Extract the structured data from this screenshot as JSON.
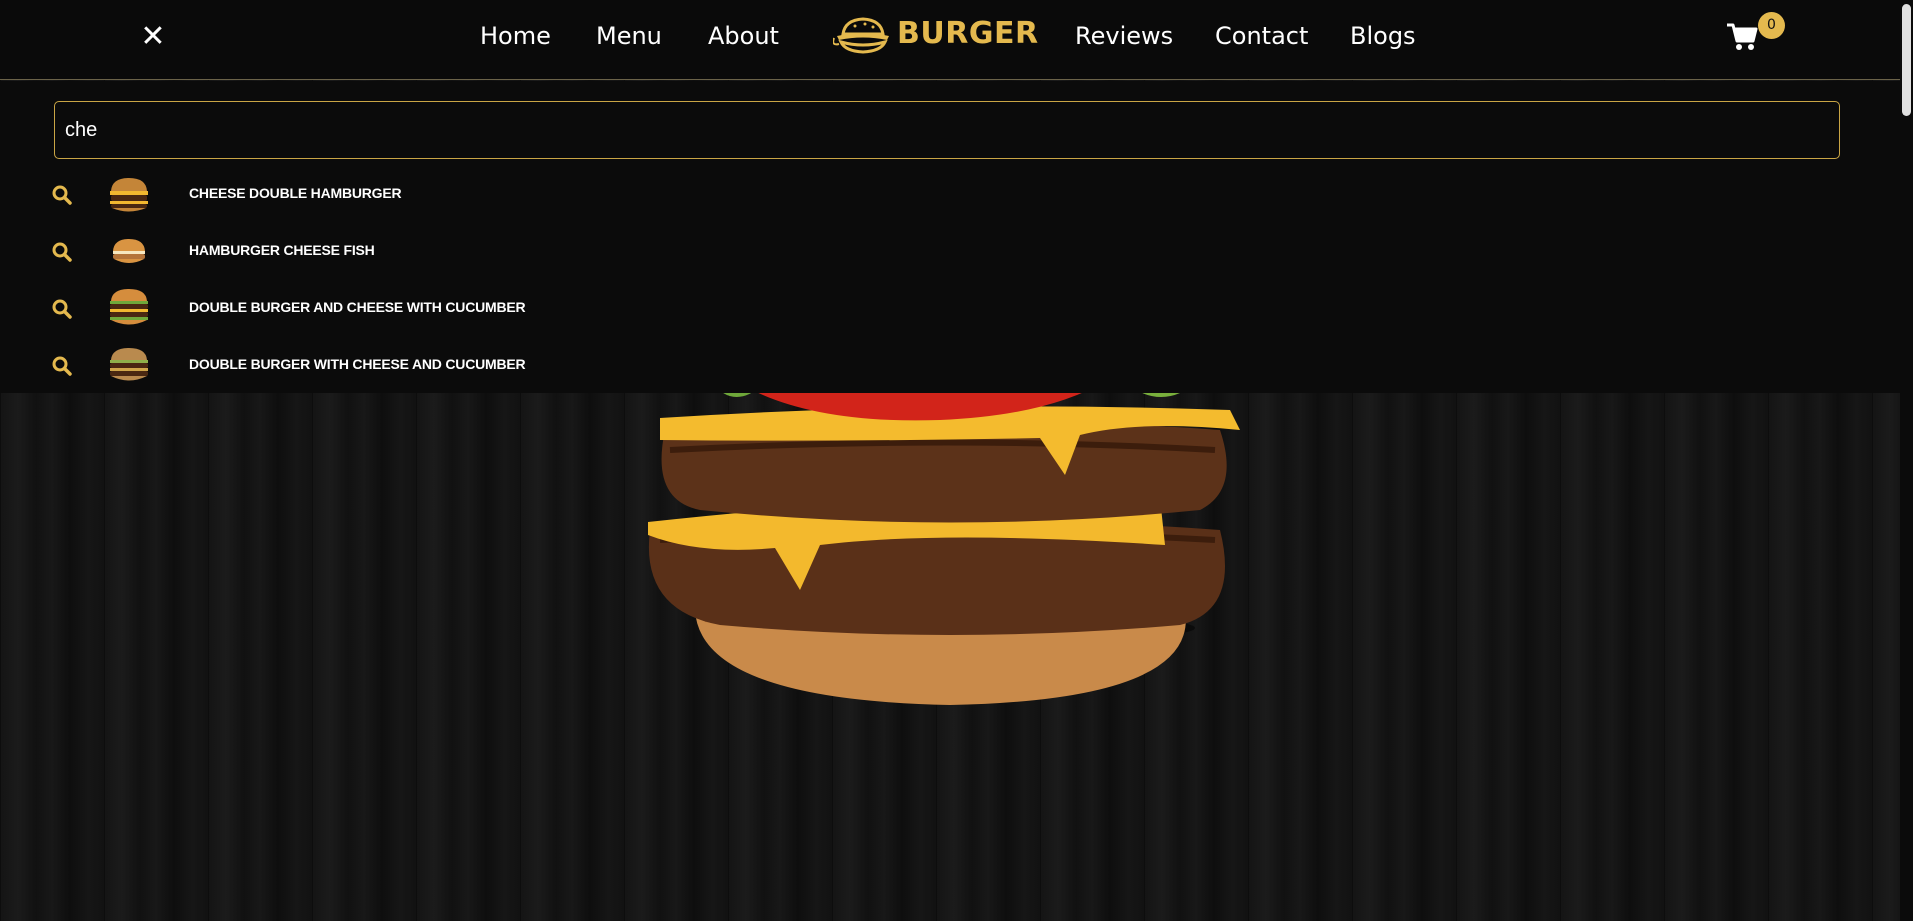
{
  "header": {
    "nav_left": [
      "Home",
      "Menu",
      "About"
    ],
    "logo_text": "BURGER",
    "nav_right": [
      "Reviews",
      "Contact",
      "Blogs"
    ],
    "cart_count": "0",
    "close_symbol": "✕"
  },
  "search": {
    "value": "che",
    "results": [
      {
        "label": "CHEESE DOUBLE HAMBURGER",
        "icon": "search-icon"
      },
      {
        "label": "HAMBURGER CHEESE FISH",
        "icon": "search-icon"
      },
      {
        "label": "DOUBLE BURGER AND CHEESE WITH CUCUMBER",
        "icon": "search-icon"
      },
      {
        "label": "DOUBLE BURGER WITH CHEESE AND CUCUMBER",
        "icon": "search-icon"
      }
    ]
  },
  "colors": {
    "accent": "#e4b94e",
    "background": "#0b0b0b",
    "border": "#c9a545"
  }
}
